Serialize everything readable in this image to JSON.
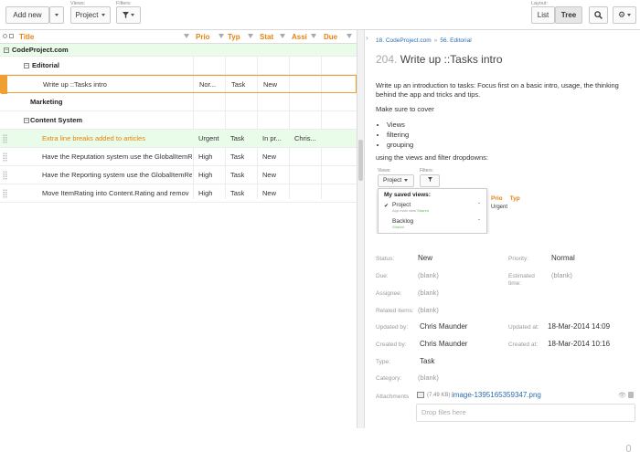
{
  "toolbar": {
    "add_new_label": "Add new",
    "views_caption": "Views:",
    "view_selected": "Project",
    "filters_caption": "Filters:",
    "layout_caption": "Layout:",
    "layout_list": "List",
    "layout_tree": "Tree",
    "layout_selected": "Tree"
  },
  "grid": {
    "columns": [
      "Title",
      "Prio",
      "Typ",
      "Stat",
      "Assi",
      "Due"
    ],
    "groups": {
      "project": "CodeProject.com",
      "editorial": "Editorial",
      "marketing": "Marketing",
      "content_system": "Content System"
    },
    "rows": [
      {
        "title": "Write up ::Tasks intro",
        "priority": "Nor...",
        "type": "Task",
        "status": "New",
        "assignee": "",
        "due": ""
      },
      {
        "title": "Extra line breaks added to articles",
        "priority": "Urgent",
        "type": "Task",
        "status": "In pr...",
        "assignee": "Chris...",
        "due": ""
      },
      {
        "title": "Have the Reputation system use the GlobalItemR",
        "priority": "High",
        "type": "Task",
        "status": "New",
        "assignee": "",
        "due": ""
      },
      {
        "title": "Have the Reporting system use the GlobalItemRe",
        "priority": "High",
        "type": "Task",
        "status": "New",
        "assignee": "",
        "due": ""
      },
      {
        "title": "Move ItemRating into Content.Rating and remov",
        "priority": "High",
        "type": "Task",
        "status": "New",
        "assignee": "",
        "due": ""
      }
    ]
  },
  "detail": {
    "breadcrumb": [
      "18. CodeProject.com",
      "56. Editorial"
    ],
    "breadcrumb_sep": "»",
    "task_number": "204.",
    "task_title": "Write up ::Tasks intro",
    "desc_p1": "Write up an introduction to tasks: Focus first on a basic intro, usage, the thinking behind the app and tricks and tips.",
    "desc_p2": "Make sure to cover",
    "bullets": [
      "Views",
      "filtering",
      "grouping"
    ],
    "desc_p3": "using the views and filter dropdowns:",
    "embedded": {
      "views_caption": "Views:",
      "filters_caption": "Filters:",
      "view_button": "Project",
      "menu_header": "My saved views:",
      "menu_items": [
        {
          "name": "Project",
          "sub": "App main view",
          "tag": "Shared",
          "checked": true
        },
        {
          "name": "Backlog",
          "sub": "",
          "tag": "Shared",
          "checked": false
        }
      ],
      "bg_col1": "Prio",
      "bg_col2": "Typ",
      "bg_val": "Urgent"
    },
    "fields": {
      "status_label": "Status:",
      "status": "New",
      "priority_label": "Priority:",
      "priority": "Normal",
      "due_label": "Due:",
      "due": "(blank)",
      "estimated_label": "Estimated time:",
      "estimated": "(blank)",
      "assignee_label": "Assignee:",
      "assignee": "(blank)",
      "related_label": "Related items:",
      "related": "(blank)",
      "updated_by_label": "Updated by:",
      "updated_by": "Chris Maunder",
      "updated_at_label": "Updated at:",
      "updated_at": "18-Mar-2014 14:09",
      "created_by_label": "Created by:",
      "created_by": "Chris Maunder",
      "created_at_label": "Created at:",
      "created_at": "18-Mar-2014 10:16",
      "type_label": "Type:",
      "type": "Task",
      "category_label": "Category:",
      "category": "(blank)",
      "attachments_label": "Attachments",
      "attachment_size": "(7.49 KB)",
      "attachment_name": "image-1395165359347.png"
    },
    "drop_placeholder": "Drop files here"
  },
  "colors": {
    "accent_orange": "#e8820c",
    "link_blue": "#2a6db0",
    "selected_row": "#e9fbe9",
    "status_green": "#5cb85c"
  }
}
